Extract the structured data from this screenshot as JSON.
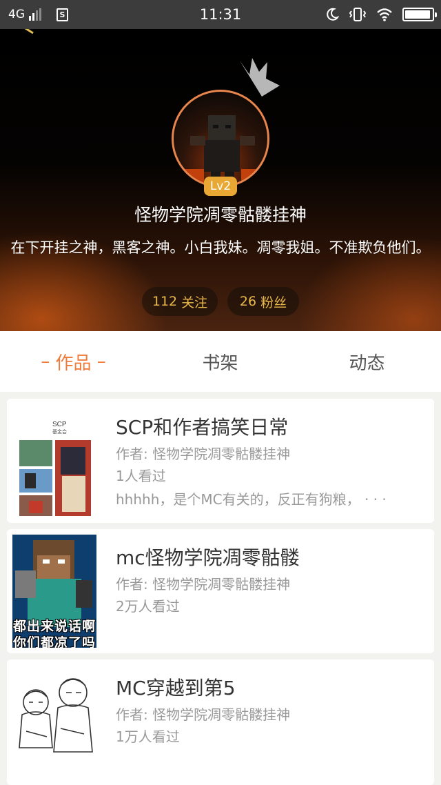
{
  "status_bar": {
    "network": "4G",
    "time": "11:31",
    "battery_level": 0.95
  },
  "profile": {
    "level": "Lv2",
    "name": "怪物学院凋零骷髅挂神",
    "bio": "在下开挂之神，黑客之神。小白我妹。凋零我姐。不准欺负他们。",
    "following_count": "112",
    "following_label": "关注",
    "fans_count": "26",
    "fans_label": "粉丝"
  },
  "tabs": [
    {
      "label": "作品",
      "active": true
    },
    {
      "label": "书架",
      "active": false
    },
    {
      "label": "动态",
      "active": false
    }
  ],
  "works": [
    {
      "title": "SCP和作者搞笑日常",
      "author": "作者: 怪物学院凋零骷髅挂神",
      "views": "1人看过",
      "description": "hhhhh，是个MC有关的，反正有狗粮，",
      "more": "· · ·",
      "cover_icon": "scp-collage-cover",
      "cover_text_top": "SCP",
      "cover_text_sub": "基金会"
    },
    {
      "title": "mc怪物学院凋零骷髅",
      "author": "作者: 怪物学院凋零骷髅挂神",
      "views": "2万人看过",
      "cover_icon": "minecraft-herobrine-cover",
      "cover_line1": "都出来说话啊",
      "cover_line2": "你们都凉了吗"
    },
    {
      "title": "MC穿越到第5",
      "author": "作者: 怪物学院凋零骷髅挂神",
      "views": "1万人看过",
      "cover_icon": "sketch-characters-cover"
    }
  ],
  "colors": {
    "accent": "#f07c3c",
    "stats_text": "#e9b94a",
    "level_badge": "#e8a833",
    "avatar_ring": "#e8854c"
  }
}
